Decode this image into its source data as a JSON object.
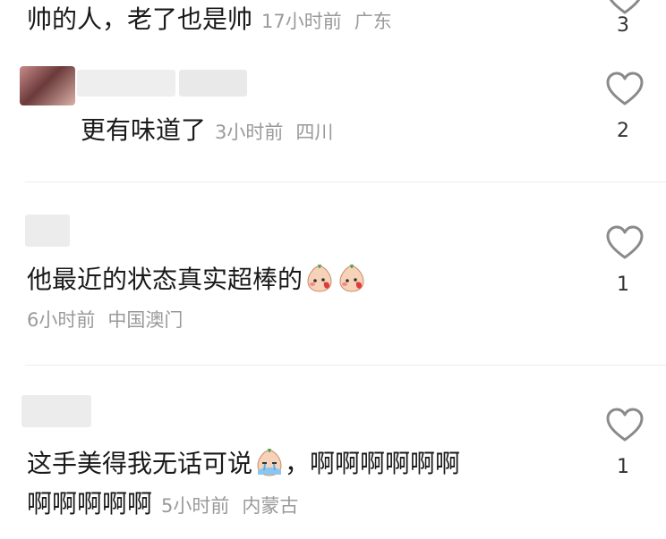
{
  "comments": [
    {
      "text": "帅的人，老了也是帅",
      "time": "17小时前",
      "location": "广东",
      "likes": "3"
    },
    {
      "text": "更有味道了",
      "time": "3小时前",
      "location": "四川",
      "likes": "2"
    },
    {
      "text": "他最近的状态真实超棒的",
      "time": "6小时前",
      "location": "中国澳门",
      "likes": "1",
      "emoji": "blushing-peach-emoji"
    },
    {
      "text_line1": "这手美得我无话可说",
      "text_line1_tail": "，啊啊啊啊啊啊",
      "text_line2": "啊啊啊啊啊",
      "time": "5小时前",
      "location": "内蒙古",
      "likes": "1",
      "emoji": "crying-peach-emoji"
    }
  ],
  "icons": {
    "like": "heart-outline-icon"
  },
  "colors": {
    "text": "#1a1a1a",
    "meta": "#9a9a9a",
    "icon": "#8a8a8a",
    "divider": "#ececec"
  }
}
